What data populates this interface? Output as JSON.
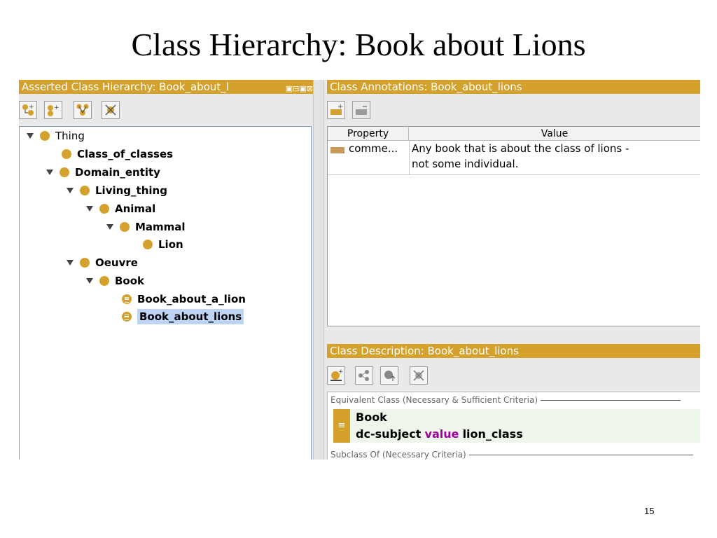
{
  "slide": {
    "title": "Class Hierarchy: Book about Lions",
    "number": "15"
  },
  "colors": {
    "panel_header": "#d4a22c",
    "selection": "#bdd4f4",
    "keyword": "#a000a0",
    "tree_border": "#7d9ec2"
  },
  "hierarchy_panel": {
    "title": "Asserted Class Hierarchy: Book_about_l",
    "toolbar": [
      "add-subclass-icon",
      "add-sibling-icon",
      "create-hierarchy-icon",
      "delete-class-icon"
    ],
    "tree": [
      {
        "label": "Thing",
        "level": 0,
        "expanded": true,
        "bold": false,
        "icon": "class"
      },
      {
        "label": "Class_of_classes",
        "level": 1,
        "expanded": null,
        "bold": true,
        "icon": "class"
      },
      {
        "label": "Domain_entity",
        "level": 1,
        "expanded": true,
        "bold": true,
        "icon": "class"
      },
      {
        "label": "Living_thing",
        "level": 2,
        "expanded": true,
        "bold": true,
        "icon": "class"
      },
      {
        "label": "Animal",
        "level": 3,
        "expanded": true,
        "bold": true,
        "icon": "class"
      },
      {
        "label": "Mammal",
        "level": 4,
        "expanded": true,
        "bold": true,
        "icon": "class"
      },
      {
        "label": "Lion",
        "level": 5,
        "expanded": null,
        "bold": true,
        "icon": "class"
      },
      {
        "label": "Oeuvre",
        "level": 2,
        "expanded": true,
        "bold": true,
        "icon": "class"
      },
      {
        "label": "Book",
        "level": 3,
        "expanded": true,
        "bold": true,
        "icon": "class"
      },
      {
        "label": "Book_about_a_lion",
        "level": 4,
        "expanded": null,
        "bold": true,
        "icon": "defined-class"
      },
      {
        "label": "Book_about_lions",
        "level": 4,
        "expanded": null,
        "bold": true,
        "icon": "defined-class",
        "selected": true
      }
    ]
  },
  "annotations_panel": {
    "title": "Class Annotations: Book_about_lions",
    "toolbar": [
      "add-annotation-icon",
      "remove-annotation-icon"
    ],
    "columns": [
      "Property",
      "Value"
    ],
    "rows": [
      {
        "property": "comme...",
        "value_line1": "Any book that is about the class of lions -",
        "value_line2": "not some individual."
      }
    ]
  },
  "description_panel": {
    "title": "Class Description: Book_about_lions",
    "toolbar": [
      "create-restriction-icon",
      "add-named-class-icon",
      "add-superclass-icon",
      "remove-icon"
    ],
    "equivalent_label": "Equivalent Class (Necessary & Sufficient Criteria)",
    "equivalent_class": "Book",
    "restriction": {
      "property": "dc-subject",
      "keyword": "value",
      "filler": "lion_class"
    },
    "subclass_label": "Subclass Of (Necessary Criteria)"
  }
}
